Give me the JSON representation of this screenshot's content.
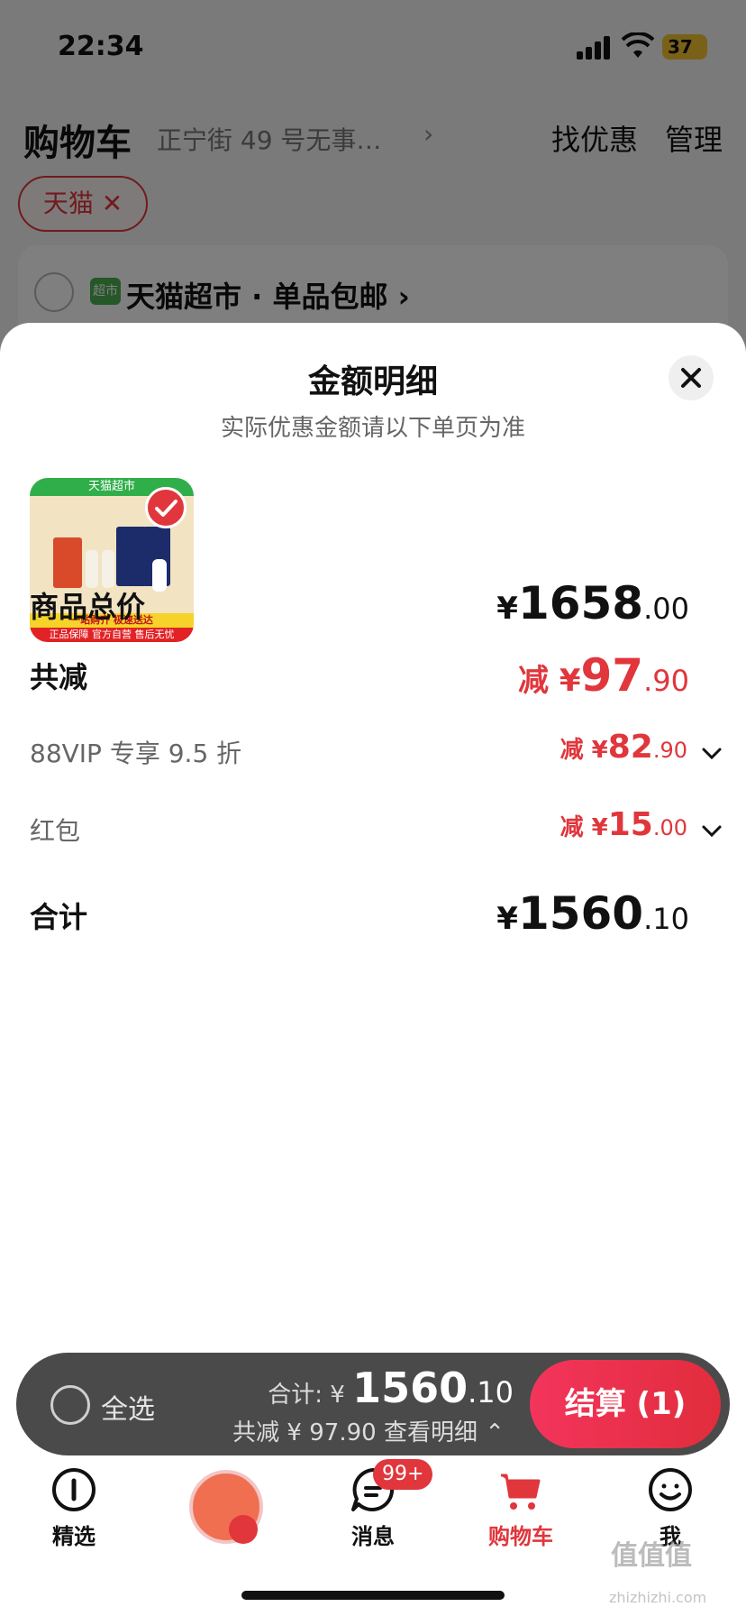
{
  "status_bar": {
    "time": "22:34",
    "battery": "37"
  },
  "cart_header": {
    "title": "购物车",
    "address": "正宁街 49 号无事…",
    "address_chevron": "›",
    "find_deals": "找优惠",
    "manage": "管理"
  },
  "filter_chip": {
    "label": "天猫 ✕"
  },
  "store": {
    "logo_text": "超市",
    "name": "天猫超市 · 单品包邮 ›"
  },
  "sheet": {
    "title": "金额明细",
    "subtitle": "实际优惠金额请以下单页为准",
    "close_icon": "close-icon",
    "product": {
      "banner": "天猫超市",
      "strip": "一站购齐 极速送达",
      "strip2": "正品保障  官方自营 售后无忧"
    },
    "rows": {
      "subtotal": {
        "label": "商品总价",
        "currency": "¥",
        "int": "1658",
        "dec": ".00"
      },
      "discount": {
        "label": "共减",
        "prefix": "减 ¥",
        "int": "97",
        "dec": ".90"
      },
      "vip": {
        "label": "88VIP 专享 9.5 折",
        "prefix": "减 ¥",
        "int": "82",
        "dec": ".90"
      },
      "redpacket": {
        "label": "红包",
        "prefix": "减 ¥",
        "int": "15",
        "dec": ".00"
      },
      "total": {
        "label": "合计",
        "currency": "¥",
        "int": "1560",
        "dec": ".10"
      }
    }
  },
  "checkout_bar": {
    "select_all": "全选",
    "total_prefix": "合计: ¥ ",
    "total_int": "1560",
    "total_dec": ".10",
    "saving": "共减 ¥ 97.90  查看明细 ⌃",
    "checkout_button": "结算 (1)"
  },
  "tabbar": {
    "tabs": [
      {
        "label": "精选",
        "icon": "home-icon"
      },
      {
        "label": "",
        "icon": "avatar-icon"
      },
      {
        "label": "消息",
        "icon": "message-icon",
        "badge": "99+"
      },
      {
        "label": "购物车",
        "icon": "cart-icon",
        "active": true
      },
      {
        "label": "我",
        "icon": "profile-icon"
      }
    ]
  },
  "watermark": {
    "text": "值值值",
    "sub": "zhizhizhi.com"
  },
  "colors": {
    "accent": "#e0363c",
    "bar": "#4a4a4a",
    "overlay": "rgba(0,0,0,0.5)"
  }
}
